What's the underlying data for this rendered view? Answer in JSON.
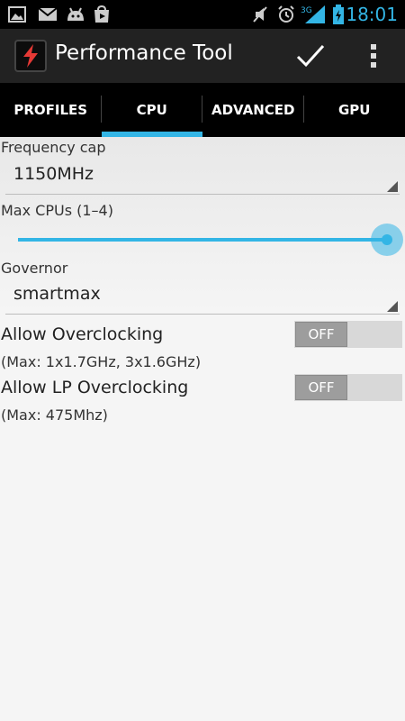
{
  "status_bar": {
    "time": "18:01",
    "network_label": "3G",
    "icons": [
      "gallery-icon",
      "gmail-icon",
      "android-icon",
      "play-store-icon",
      "mute-icon",
      "alarm-icon",
      "signal-icon",
      "battery-icon"
    ]
  },
  "action_bar": {
    "title": "Performance Tool",
    "app_icon": "lightning-bolt-icon",
    "actions": [
      "checkmark-icon",
      "overflow-menu-icon"
    ]
  },
  "tabs": [
    {
      "label": "PROFILES",
      "active": false
    },
    {
      "label": "CPU",
      "active": true
    },
    {
      "label": "ADVANCED",
      "active": false
    },
    {
      "label": "GPU",
      "active": false
    }
  ],
  "cpu": {
    "frequency_cap_label": "Frequency cap",
    "frequency_cap_value": "1150MHz",
    "max_cpus_label": "Max CPUs (1–4)",
    "max_cpus_slider_fraction": 1.0,
    "governor_label": "Governor",
    "governor_value": "smartmax",
    "allow_overclocking_label": "Allow Overclocking",
    "allow_overclocking_state": "OFF",
    "allow_overclocking_note": "(Max: 1x1.7GHz, 3x1.6GHz)",
    "allow_lp_overclocking_label": "Allow LP Overclocking",
    "allow_lp_overclocking_state": "OFF",
    "allow_lp_overclocking_note": "(Max: 475Mhz)"
  },
  "colors": {
    "accent": "#33b5e5",
    "toolbar": "#222222",
    "tab_bar": "#000000",
    "app_icon_bolt": "#e53935"
  }
}
